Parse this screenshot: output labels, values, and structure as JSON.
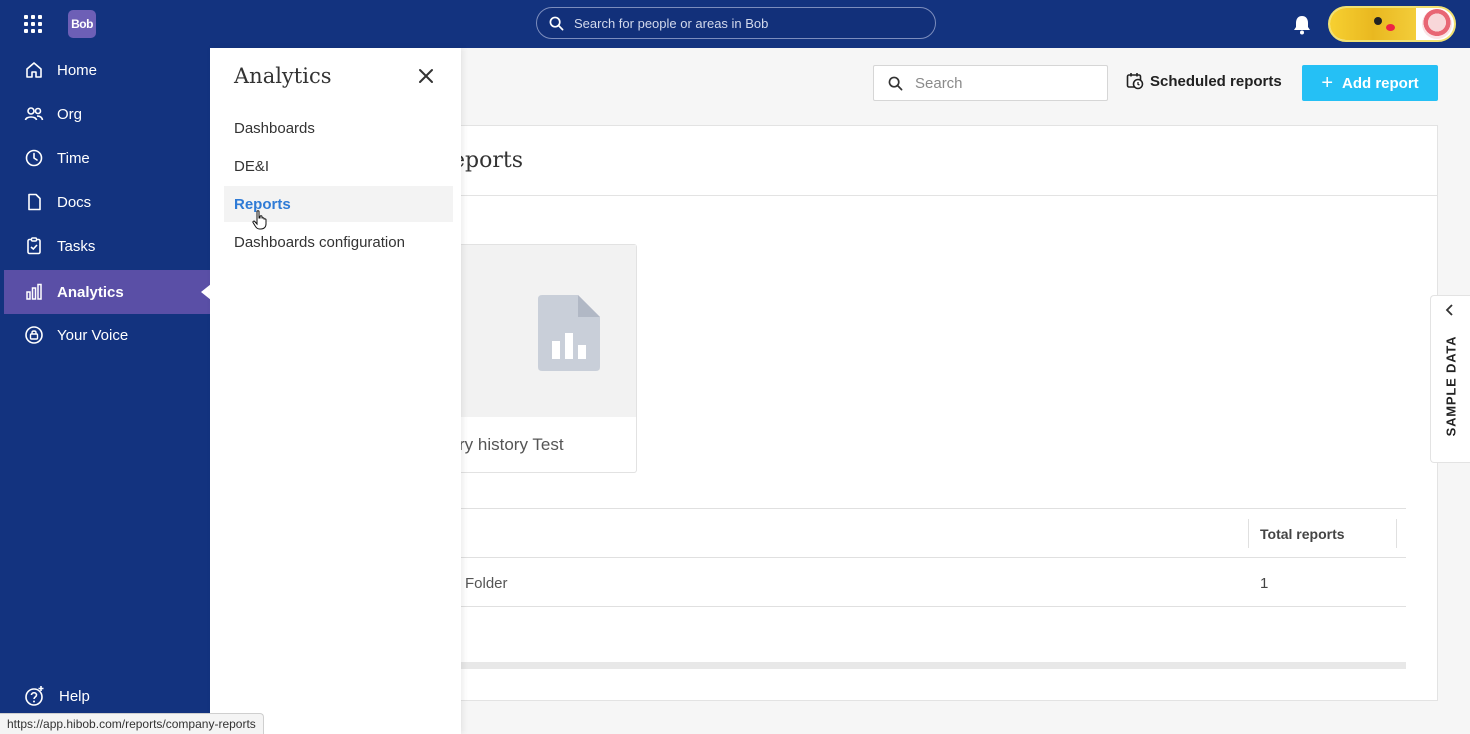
{
  "topbar": {
    "logo_text": "Bob",
    "search_placeholder": "Search for people or areas in Bob"
  },
  "sidebar": {
    "items": [
      {
        "label": "Home",
        "icon": "home-icon"
      },
      {
        "label": "Org",
        "icon": "people-icon"
      },
      {
        "label": "Time",
        "icon": "clock-icon"
      },
      {
        "label": "Docs",
        "icon": "document-icon"
      },
      {
        "label": "Tasks",
        "icon": "clipboard-icon"
      },
      {
        "label": "Analytics",
        "icon": "bar-chart-icon",
        "active": true
      },
      {
        "label": "Your Voice",
        "icon": "lock-badge-icon"
      }
    ],
    "help_label": "Help"
  },
  "flyout": {
    "title": "Analytics",
    "items": [
      {
        "label": "Dashboards"
      },
      {
        "label": "DE&I"
      },
      {
        "label": "Reports",
        "active": true
      },
      {
        "label": "Dashboards configuration"
      }
    ]
  },
  "toolbar": {
    "search_placeholder": "Search",
    "scheduled_label": "Scheduled reports",
    "add_label": "Add report"
  },
  "panel": {
    "heading": "eports",
    "card_name": "ry history Test",
    "table": {
      "total_header": "Total reports",
      "rows": [
        {
          "name": "Folder",
          "total": "1"
        }
      ]
    }
  },
  "sample_tab_label": "SAMPLE DATA",
  "status_url": "https://app.hibob.com/reports/company-reports",
  "colors": {
    "nav_bg": "#13337f",
    "active_nav": "#5a4fa6",
    "accent_blue": "#25c0f5",
    "link_blue": "#2f7bd6"
  }
}
